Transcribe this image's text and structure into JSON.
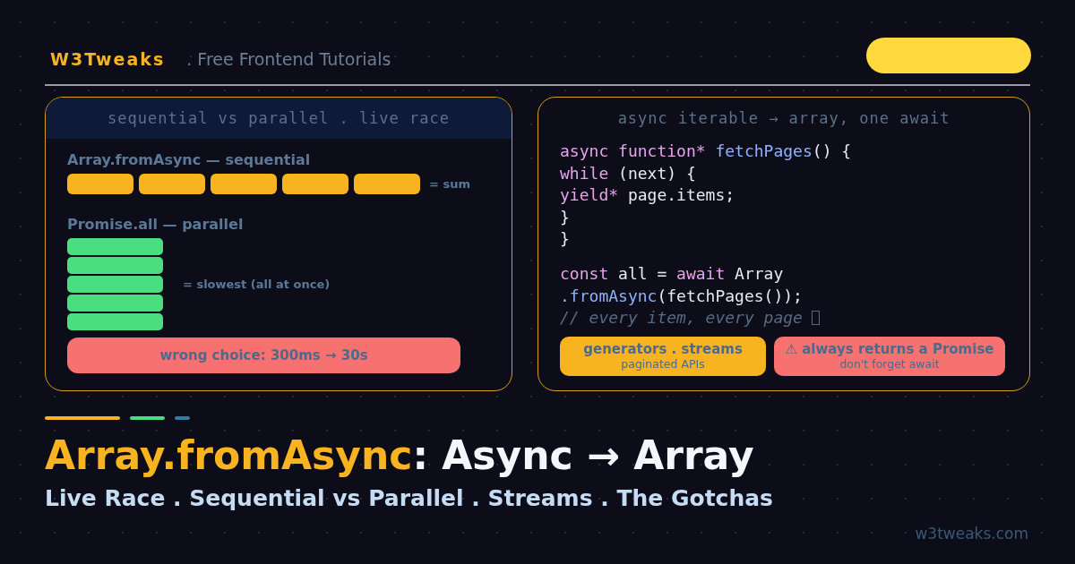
{
  "header": {
    "brand": "W3Tweaks",
    "tagline": ". Free Frontend Tutorials"
  },
  "race_panel": {
    "title": "sequential vs parallel . live race",
    "sequential": {
      "label": "Array.fromAsync — sequential",
      "note": "= sum",
      "bars": [
        {
          "color": "#f8b420"
        },
        {
          "color": "#f8b420"
        },
        {
          "color": "#f8b420"
        },
        {
          "color": "#f8b420"
        },
        {
          "color": "#f8b420"
        }
      ]
    },
    "parallel": {
      "label": "Promise.all — parallel",
      "note": "= slowest (all at once)",
      "bars": [
        {
          "color": "#4ade80"
        },
        {
          "color": "#4ade80"
        },
        {
          "color": "#4ade80"
        },
        {
          "color": "#4ade80"
        },
        {
          "color": "#4ade80"
        }
      ]
    },
    "warning": "wrong choice: 300ms → 30s"
  },
  "code_panel": {
    "title": "async iterable → array, one await",
    "blocks": [
      [
        [
          {
            "text": "async function* ",
            "kind": "keyword"
          },
          {
            "text": "fetchPages",
            "kind": "fn"
          },
          {
            "text": "() {",
            "kind": "plain"
          }
        ],
        [
          {
            "text": "while",
            "kind": "keyword"
          },
          {
            "text": " (next) {",
            "kind": "plain"
          }
        ],
        [
          {
            "text": "yield*",
            "kind": "keyword"
          },
          {
            "text": " page.items;",
            "kind": "plain"
          }
        ],
        [
          {
            "text": "}",
            "kind": "plain"
          }
        ],
        [
          {
            "text": "}",
            "kind": "plain"
          }
        ]
      ],
      [
        [
          {
            "text": "const",
            "kind": "keyword"
          },
          {
            "text": " all = ",
            "kind": "plain"
          },
          {
            "text": "await",
            "kind": "keyword"
          },
          {
            "text": " Array",
            "kind": "plain"
          }
        ],
        [
          {
            "text": ".fromAsync",
            "kind": "fn"
          },
          {
            "text": "(fetchPages());",
            "kind": "plain"
          }
        ],
        [
          {
            "text": "// every item, every page",
            "kind": "comment"
          },
          {
            "kind": "tofu"
          }
        ]
      ]
    ],
    "tags": [
      {
        "title": "generators . streams",
        "sub": "paginated APIs",
        "color": "#f8b420"
      },
      {
        "title": "⚠ always returns a Promise",
        "sub": "don't forget await",
        "color": "#f87171"
      }
    ]
  },
  "accents": [
    {
      "color": "#f8b420"
    },
    {
      "color": "#4ade80"
    },
    {
      "color": "#2d7ea8"
    }
  ],
  "headline": {
    "highlight": "Array.fromAsync",
    "rest": ": Async → Array"
  },
  "subtitle": "Live Race . Sequential vs Parallel . Streams . The Gotchas",
  "footer_url": "w3tweaks.com"
}
